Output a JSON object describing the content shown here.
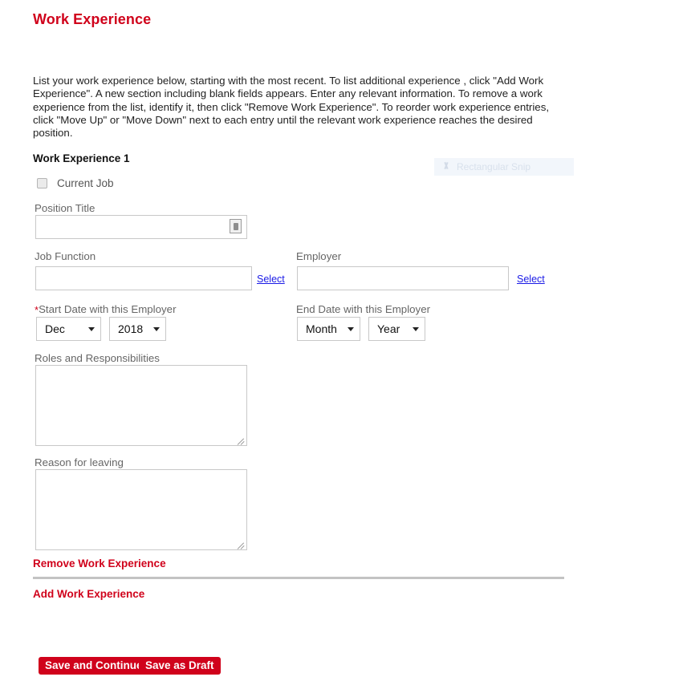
{
  "page": {
    "title": "Work Experience",
    "intro": "List your work experience below, starting with the most recent. To list additional experience , click \"Add Work Experience\". A new section including blank fields appears. Enter any relevant information. To remove a work experience from the list, identify it, then click \"Remove Work Experience\". To reorder work experience entries, click \"Move Up\" or \"Move Down\" next to each entry until the relevant work experience reaches the desired position.",
    "accent_color": "#d0021b",
    "link_color": "#1a1ae6"
  },
  "overlay": {
    "label": "Rectangular Snip",
    "icon": "snip-scissors-icon"
  },
  "section": {
    "heading": "Work Experience 1",
    "current_job": {
      "label": "Current Job",
      "checked": false
    },
    "position_title": {
      "label": "Position Title",
      "value": "",
      "placeholder": ""
    },
    "job_function": {
      "label": "Job Function",
      "value": "",
      "placeholder": "",
      "select_link": "Select"
    },
    "employer": {
      "label": "Employer",
      "value": "",
      "placeholder": "",
      "select_link": "Select"
    },
    "start_date": {
      "label": "Start Date with this Employer",
      "required": true,
      "required_marker": "*",
      "month": "Dec",
      "year": "2018"
    },
    "end_date": {
      "label": "End Date with this Employer",
      "required": false,
      "month": "Month",
      "year": "Year"
    },
    "roles": {
      "label": "Roles and Responsibilities",
      "value": "",
      "placeholder": ""
    },
    "reason_for_leaving": {
      "label": "Reason for leaving",
      "value": "",
      "placeholder": ""
    }
  },
  "actions": {
    "remove_work_experience": "Remove Work Experience",
    "add_work_experience": "Add Work Experience"
  },
  "footer": {
    "save_and_continue": "Save and Continue",
    "save_as_draft": "Save as Draft"
  }
}
